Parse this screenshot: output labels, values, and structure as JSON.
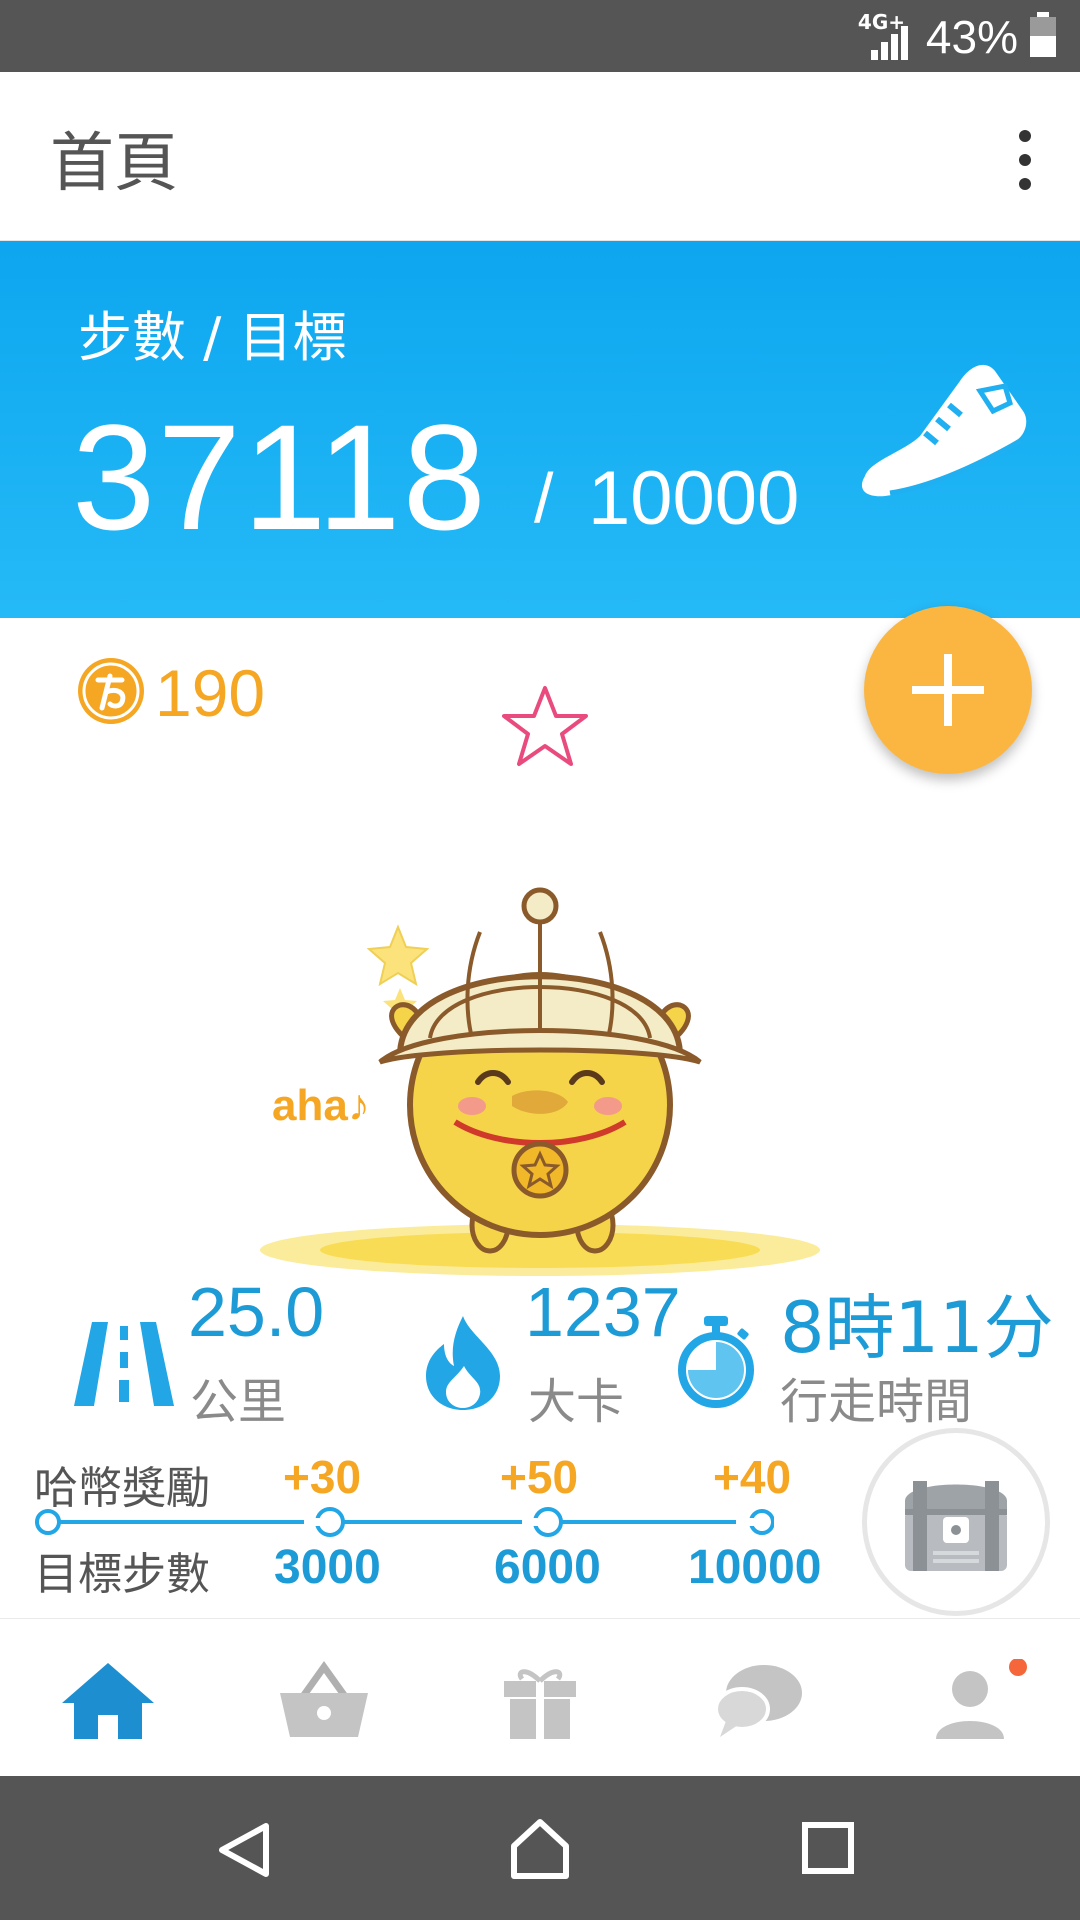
{
  "status_bar": {
    "network": "4G+",
    "battery": "43%"
  },
  "app_bar": {
    "title": "首頁",
    "menu_icon": "more-vert-icon"
  },
  "steps": {
    "label": "步數 / 目標",
    "value": "37118",
    "separator": "/",
    "goal": "10000",
    "icon": "running-shoe-icon"
  },
  "coins": {
    "value": "190",
    "icon": "aha-coin-icon"
  },
  "mascot": {
    "text": "aha♪"
  },
  "stats": {
    "distance": {
      "value": "25.0",
      "unit": "公里",
      "icon": "road-icon"
    },
    "calories": {
      "value": "1237",
      "unit": "大卡",
      "icon": "fire-icon"
    },
    "time": {
      "value": "8時11分",
      "unit": "行走時間",
      "icon": "stopwatch-icon"
    }
  },
  "rewards": {
    "reward_label": "哈幣獎勵",
    "goal_label": "目標步數",
    "milestones": [
      {
        "bonus": "+30",
        "steps": "3000"
      },
      {
        "bonus": "+50",
        "steps": "6000"
      },
      {
        "bonus": "+40",
        "steps": "10000"
      }
    ]
  },
  "bottom_nav": [
    {
      "name": "home",
      "icon": "home-icon",
      "active": true
    },
    {
      "name": "shop",
      "icon": "basket-icon",
      "active": false
    },
    {
      "name": "gift",
      "icon": "gift-icon",
      "active": false
    },
    {
      "name": "chat",
      "icon": "chat-icon",
      "active": false
    },
    {
      "name": "profile",
      "icon": "profile-icon",
      "active": false,
      "badge": true
    }
  ],
  "colors": {
    "primary_blue": "#1d9bd6",
    "banner_blue": "#0da6ef",
    "accent_orange": "#f5a623",
    "fab_orange": "#fbb642"
  }
}
